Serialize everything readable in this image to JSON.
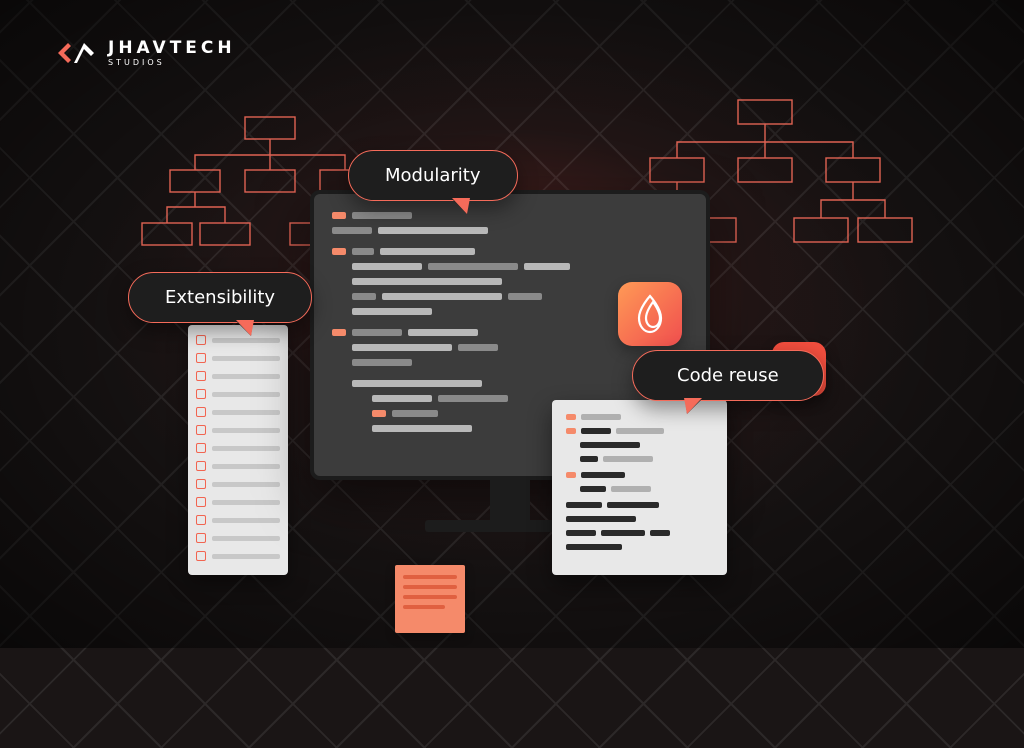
{
  "logo": {
    "main": "JHAVTECH",
    "sub": "STUDIOS"
  },
  "bubbles": {
    "modularity": "Modularity",
    "extensibility": "Extensibility",
    "codereuse": "Code reuse"
  },
  "icons": {
    "drop": "fire-drop-icon",
    "check": "checkmark-icon"
  },
  "colors": {
    "accent": "#f56b5a",
    "accent2": "#f24e3e"
  }
}
